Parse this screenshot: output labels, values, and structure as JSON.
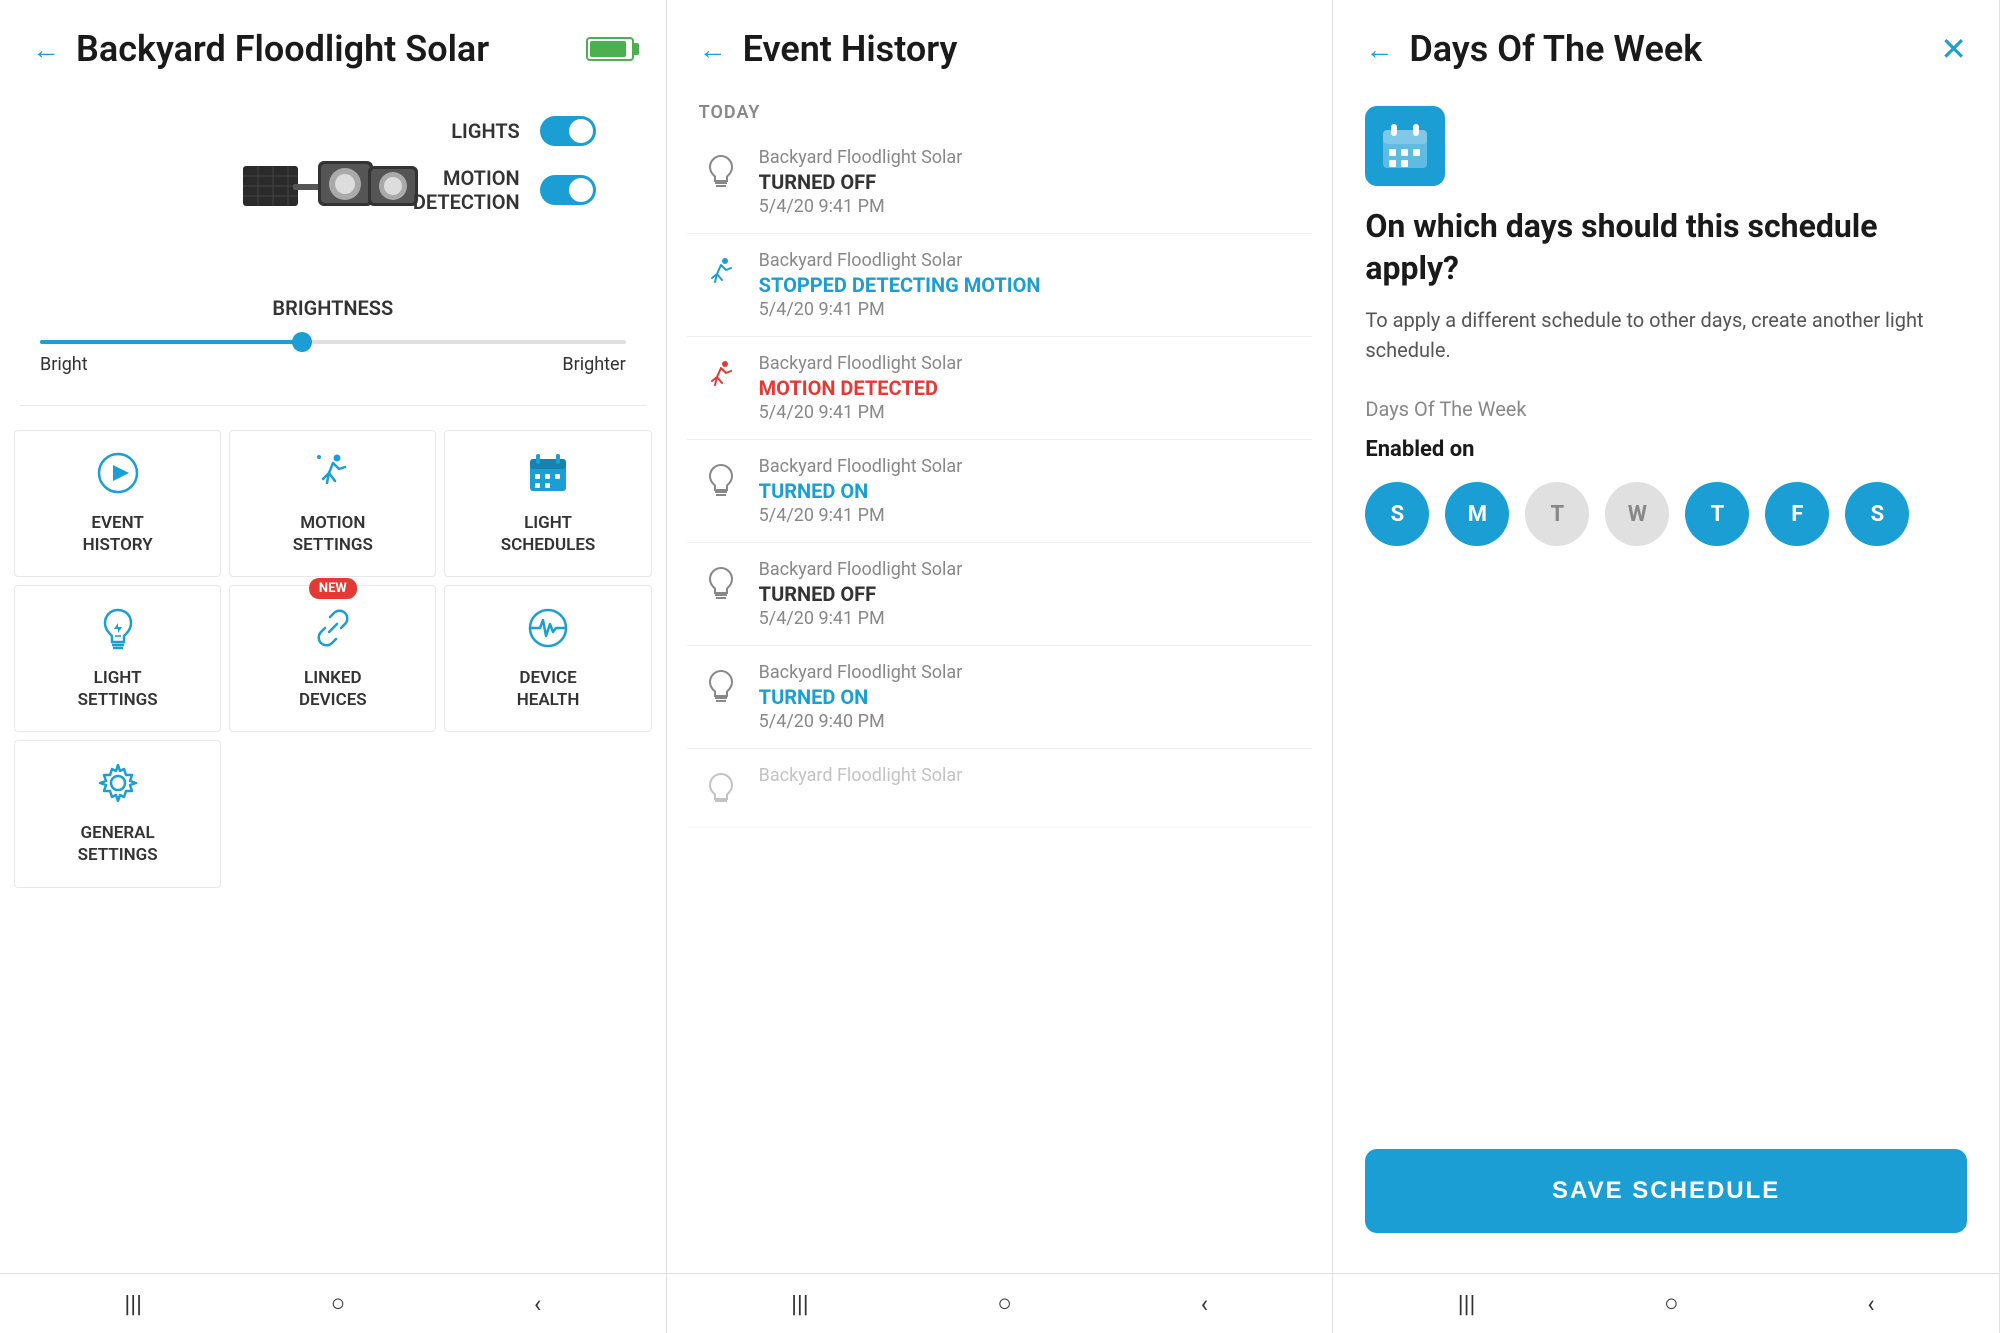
{
  "panel1": {
    "title": "Backyard Floodlight Solar",
    "controls": {
      "lights_label": "LIGHTS",
      "motion_label": "MOTION\nDETECTION"
    },
    "brightness": {
      "label": "BRIGHTNESS",
      "min": "Bright",
      "max": "Brighter"
    },
    "menu": [
      {
        "id": "event-history",
        "label": "EVENT\nHISTORY",
        "icon": "play-circle"
      },
      {
        "id": "motion-settings",
        "label": "MOTION\nSETTINGS",
        "icon": "running"
      },
      {
        "id": "light-schedules",
        "label": "LIGHT\nSCHEDULES",
        "icon": "calendar",
        "new": false
      },
      {
        "id": "light-settings",
        "label": "LIGHT\nSETTINGS",
        "icon": "bulb",
        "new": false
      },
      {
        "id": "linked-devices",
        "label": "LINKED\nDEVICES",
        "icon": "link",
        "new": true
      },
      {
        "id": "device-health",
        "label": "DEVICE\nHEALTH",
        "icon": "pulse"
      },
      {
        "id": "general-settings",
        "label": "GENERAL\nSETTINGS",
        "icon": "gear"
      }
    ],
    "nav": [
      "|||",
      "○",
      "‹"
    ]
  },
  "panel2": {
    "title": "Event History",
    "section": "TODAY",
    "events": [
      {
        "device": "Backyard Floodlight Solar",
        "status": "TURNED OFF",
        "status_color": "dark",
        "time": "5/4/20 9:41 PM",
        "icon": "bulb-dim"
      },
      {
        "device": "Backyard Floodlight Solar",
        "status": "STOPPED DETECTING MOTION",
        "status_color": "blue",
        "time": "5/4/20 9:41 PM",
        "icon": "run-blue"
      },
      {
        "device": "Backyard Floodlight Solar",
        "status": "MOTION DETECTED",
        "status_color": "red",
        "time": "5/4/20 9:41 PM",
        "icon": "run-red"
      },
      {
        "device": "Backyard Floodlight Solar",
        "status": "TURNED ON",
        "status_color": "blue",
        "time": "5/4/20 9:41 PM",
        "icon": "bulb-dim"
      },
      {
        "device": "Backyard Floodlight Solar",
        "status": "TURNED OFF",
        "status_color": "dark",
        "time": "5/4/20 9:41 PM",
        "icon": "bulb-dim"
      },
      {
        "device": "Backyard Floodlight Solar",
        "status": "TURNED ON",
        "status_color": "blue",
        "time": "5/4/20 9:40 PM",
        "icon": "bulb-dim"
      },
      {
        "device": "Backyard Floodlight Solar",
        "status": "",
        "status_color": "dark",
        "time": "",
        "icon": "bulb-dim",
        "partial": true
      }
    ],
    "nav": [
      "|||",
      "○",
      "‹"
    ]
  },
  "panel3": {
    "title": "Days Of The Week",
    "question": "On which days should this schedule apply?",
    "description": "To apply a different schedule to other days, create another light schedule.",
    "section_label": "Days Of The Week",
    "enabled_label": "Enabled on",
    "days": [
      {
        "letter": "S",
        "active": true
      },
      {
        "letter": "M",
        "active": true
      },
      {
        "letter": "T",
        "active": false
      },
      {
        "letter": "W",
        "active": false
      },
      {
        "letter": "T",
        "active": true
      },
      {
        "letter": "F",
        "active": true
      },
      {
        "letter": "S",
        "active": true
      }
    ],
    "save_button": "SAVE SCHEDULE",
    "nav": [
      "|||",
      "○",
      "‹"
    ]
  }
}
